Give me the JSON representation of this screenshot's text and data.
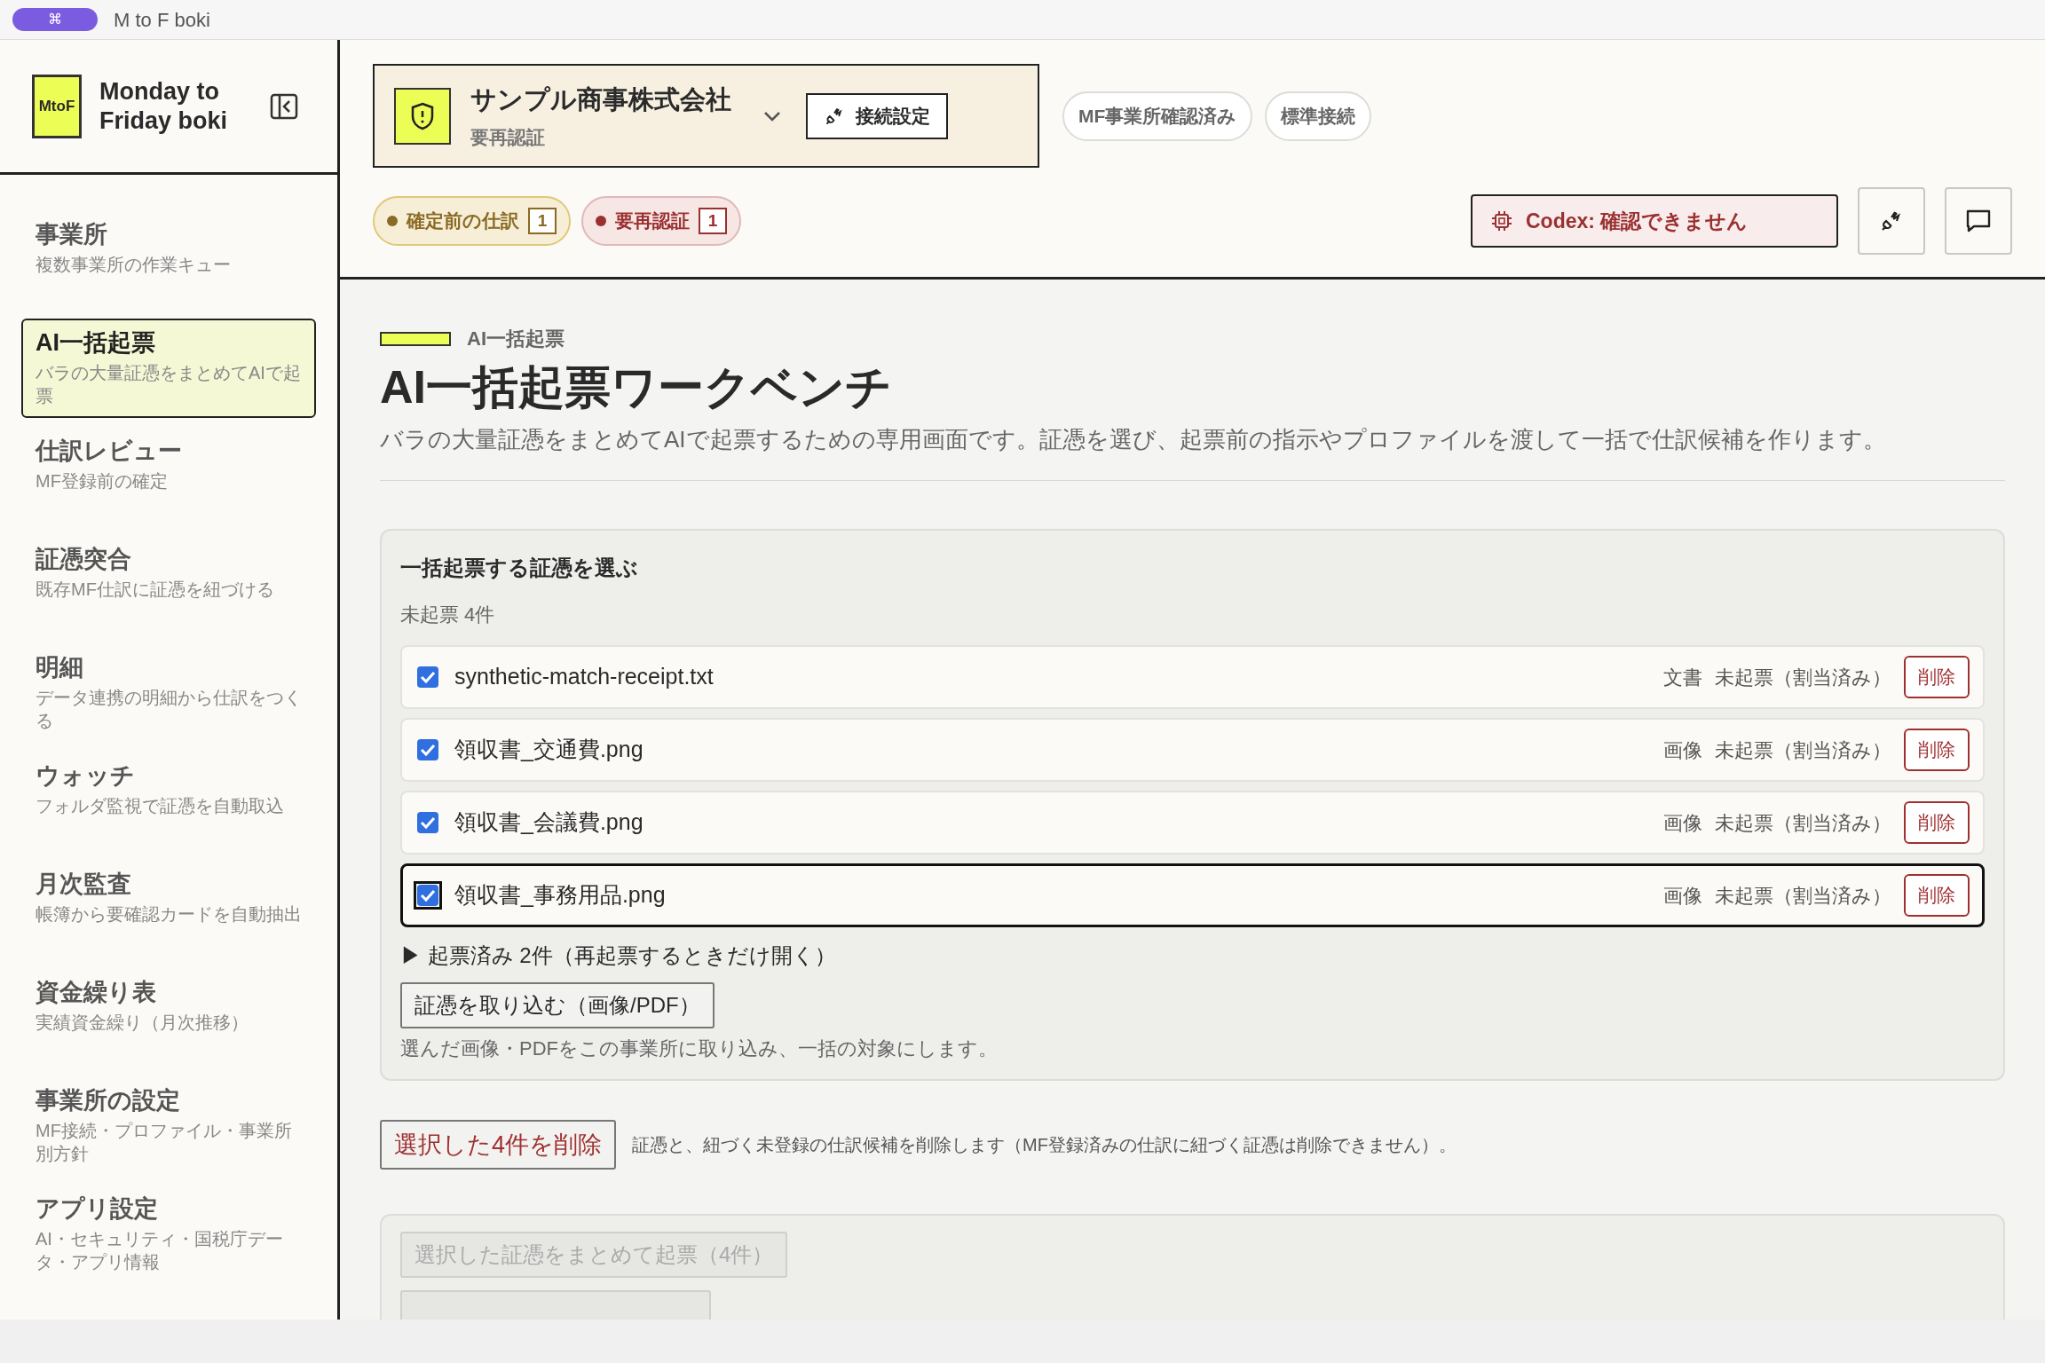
{
  "window": {
    "badge": "⌘",
    "title": "M to F boki"
  },
  "sidebar": {
    "logo": "MtoF",
    "app_name": "Monday to Friday boki",
    "items": [
      {
        "title": "事業所",
        "subtitle": "複数事業所の作業キュー",
        "selected": false
      },
      {
        "title": "AI一括起票",
        "subtitle": "バラの大量証憑をまとめてAIで起票",
        "selected": true
      },
      {
        "title": "仕訳レビュー",
        "subtitle": "MF登録前の確定",
        "selected": false
      },
      {
        "title": "証憑突合",
        "subtitle": "既存MF仕訳に証憑を紐づける",
        "selected": false
      },
      {
        "title": "明細",
        "subtitle": "データ連携の明細から仕訳をつくる",
        "selected": false
      },
      {
        "title": "ウォッチ",
        "subtitle": "フォルダ監視で証憑を自動取込",
        "selected": false
      },
      {
        "title": "月次監査",
        "subtitle": "帳簿から要確認カードを自動抽出",
        "selected": false
      },
      {
        "title": "資金繰り表",
        "subtitle": "実績資金繰り（月次推移）",
        "selected": false
      },
      {
        "title": "事業所の設定",
        "subtitle": "MF接続・プロファイル・事業所別方針",
        "selected": false
      },
      {
        "title": "アプリ設定",
        "subtitle": "AI・セキュリティ・国税庁データ・アプリ情報",
        "selected": false
      }
    ]
  },
  "header": {
    "company": {
      "name": "サンプル商事株式会社",
      "status": "要再認証",
      "connect_button": "接続設定"
    },
    "pills": [
      "MF事業所確認済み",
      "標準接続"
    ],
    "badges": [
      {
        "label": "確定前の仕訳",
        "count": "1",
        "color": "#8a6a24"
      },
      {
        "label": "要再認証",
        "count": "1",
        "color": "#9a3030"
      }
    ],
    "codex_status": "Codex: 確認できません"
  },
  "main": {
    "eyebrow": "AI一括起票",
    "title": "AI一括起票ワークベンチ",
    "description": "バラの大量証憑をまとめてAIで起票するための専用画面です。証憑を選び、起票前の指示やプロファイルを渡して一括で仕訳候補を作ります。",
    "select_card": {
      "title": "一括起票する証憑を選ぶ",
      "count": "未起票 4件",
      "files": [
        {
          "name": "synthetic-match-receipt.txt",
          "type": "文書",
          "status": "未起票（割当済み）",
          "delete": "削除",
          "checked": true,
          "focused": false
        },
        {
          "name": "領収書_交通費.png",
          "type": "画像",
          "status": "未起票（割当済み）",
          "delete": "削除",
          "checked": true,
          "focused": false
        },
        {
          "name": "領収書_会議費.png",
          "type": "画像",
          "status": "未起票（割当済み）",
          "delete": "削除",
          "checked": true,
          "focused": false
        },
        {
          "name": "領収書_事務用品.png",
          "type": "画像",
          "status": "未起票（割当済み）",
          "delete": "削除",
          "checked": true,
          "focused": true
        }
      ],
      "collapsed_section": {
        "marker": "▶",
        "label": "起票済み 2件（再起票するときだけ開く）",
        "expanded": false
      },
      "import_button": "証憑を取り込む（画像/PDF）",
      "import_hint": "選んだ画像・PDFをこの事業所に取り込み、一括の対象にします。"
    },
    "delete_selected": {
      "button": "選択した4件を削除",
      "note": "証憑と、紐づく未登録の仕訳候補を削除します（MF登録済みの仕訳に紐づく証憑は削除できません）。"
    },
    "actions_card": {
      "buttons": [
        {
          "label": "選択した証憑をまとめて起票（4件）",
          "disabled": true
        }
      ]
    }
  }
}
